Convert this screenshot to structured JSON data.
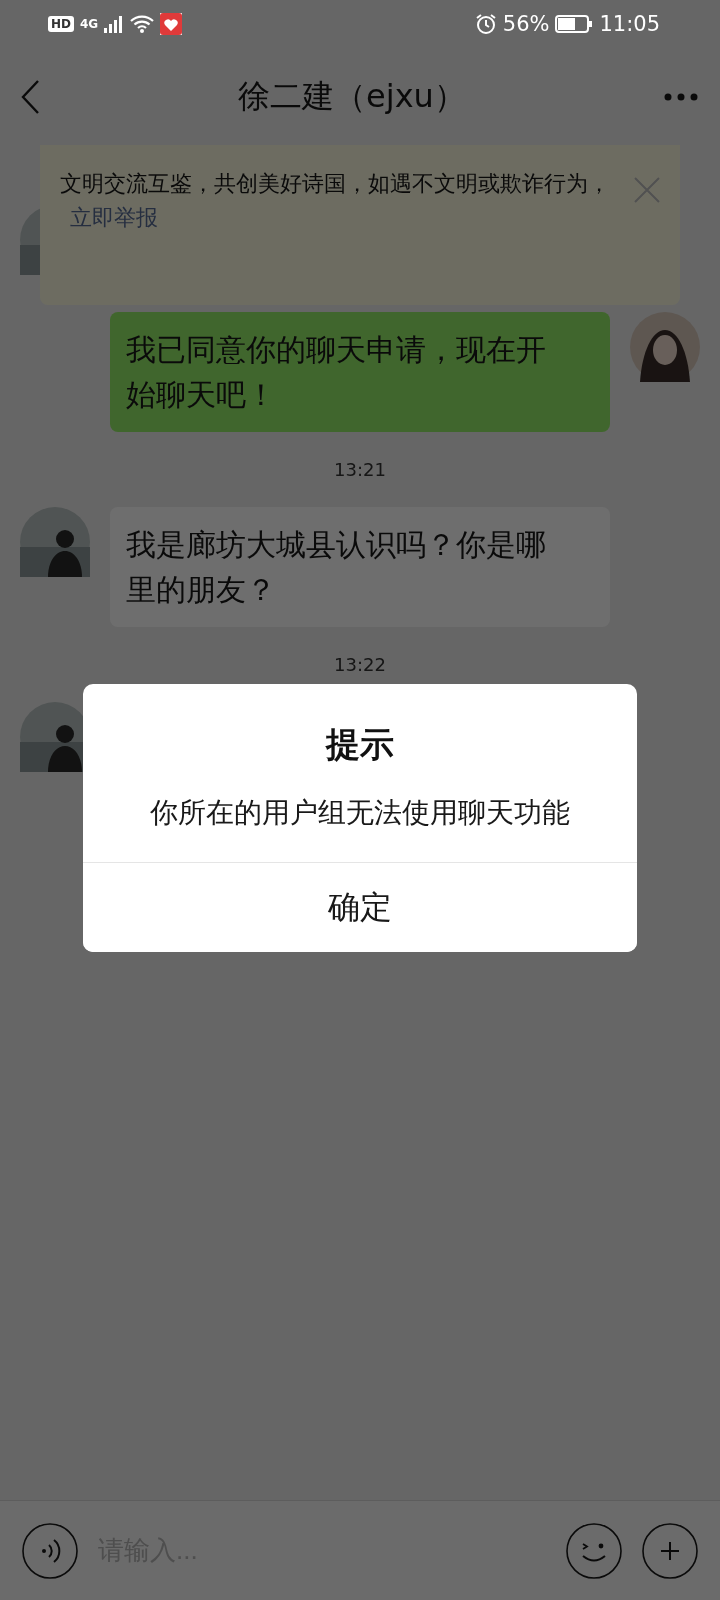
{
  "status_bar": {
    "hd": "HD",
    "network": "4G",
    "battery_percent": "56%",
    "time": "11:05"
  },
  "header": {
    "title": "徐二建（ejxu）"
  },
  "notice": {
    "text": "文明交流互鉴，共创美好诗国，如遇不文明或欺诈行为，",
    "link": "立即举报"
  },
  "messages": [
    {
      "kind": "received"
    },
    {
      "kind": "sent",
      "text": "我已同意你的聊天申请，现在开始聊天吧！"
    },
    {
      "kind": "time",
      "text": "13:21"
    },
    {
      "kind": "received",
      "text": "我是廊坊大城县认识吗？你是哪里的朋友？"
    },
    {
      "kind": "time",
      "text": "13:22"
    },
    {
      "kind": "received"
    }
  ],
  "input_bar": {
    "placeholder": "请输入..."
  },
  "dialog": {
    "title": "提示",
    "message": "你所在的用户组无法使用聊天功能",
    "button": "确定"
  }
}
